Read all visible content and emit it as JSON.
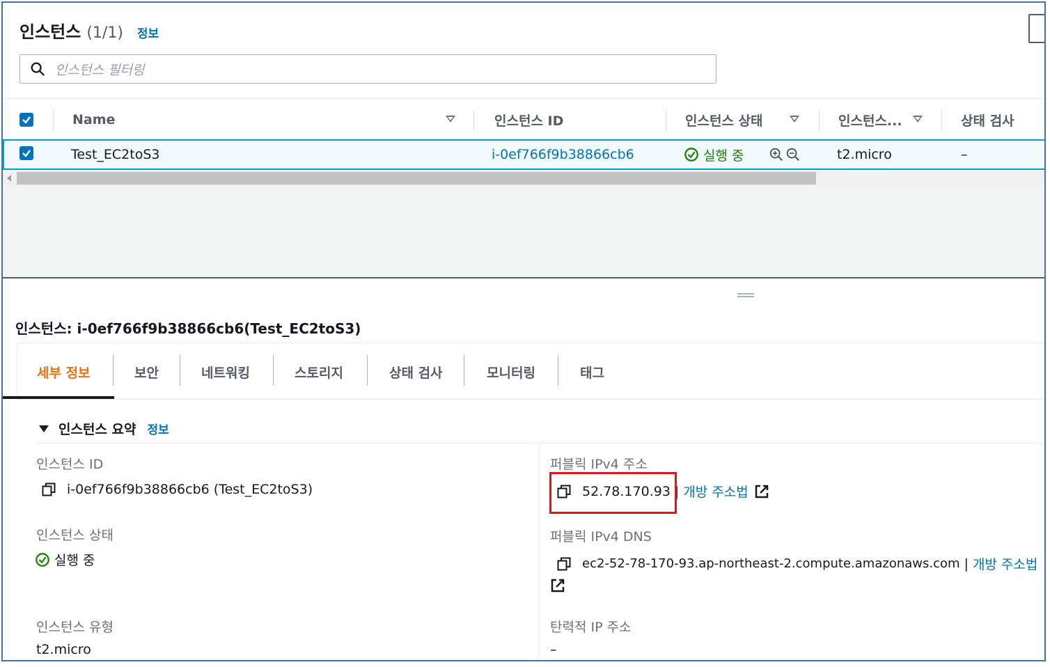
{
  "instances_panel": {
    "title": "인스턴스",
    "count": "(1/1)",
    "info_link": "정보",
    "search_placeholder": "인스턴스 필터링"
  },
  "table": {
    "columns": [
      "Name",
      "인스턴스 ID",
      "인스턴스 상태",
      "인스턴스...",
      "상태 검사"
    ],
    "rows": [
      {
        "name": "Test_EC2toS3",
        "instance_id": "i-0ef766f9b38866cb6",
        "state": "실행 중",
        "type": "t2.micro",
        "status_check": "–",
        "selected": true
      }
    ]
  },
  "detail": {
    "title": "인스턴스: i-0ef766f9b38866cb6(Test_EC2toS3)",
    "tabs": [
      "세부 정보",
      "보안",
      "네트워킹",
      "스토리지",
      "상태 검사",
      "모니터링",
      "태그"
    ],
    "active_tab": "세부 정보",
    "summary_title": "인스턴스 요약",
    "summary_info": "정보",
    "fields": {
      "instance_id_label": "인스턴스 ID",
      "instance_id_value": "i-0ef766f9b38866cb6 (Test_EC2toS3)",
      "instance_state_label": "인스턴스 상태",
      "instance_state_value": "실행 중",
      "instance_type_label": "인스턴스 유형",
      "instance_type_value": "t2.micro",
      "public_ipv4_label": "퍼블릭 IPv4 주소",
      "public_ipv4_value": "52.78.170.93",
      "public_ipv4_sep": "|",
      "public_ipv4_link": "개방 주소법",
      "public_dns_label": "퍼블릭 IPv4 DNS",
      "public_dns_value": "ec2-52-78-170-93.ap-northeast-2.compute.amazonaws.com",
      "public_dns_sep": "|",
      "public_dns_link": "개방 주소법",
      "elastic_ip_label": "탄력적 IP 주소",
      "elastic_ip_value": "–"
    }
  },
  "colors": {
    "link": "#0073bb",
    "active_tab": "#ec7211",
    "running": "#1d8102",
    "highlight_box": "#e0161b",
    "checkbox": "#0073bb"
  },
  "icons": [
    "search-icon",
    "checkbox-checked-icon",
    "sort-down-icon",
    "check-circle-icon",
    "zoom-in-icon",
    "zoom-out-icon",
    "copy-icon",
    "external-link-icon",
    "caret-down-icon"
  ]
}
